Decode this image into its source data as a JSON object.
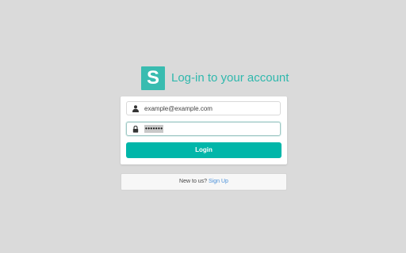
{
  "header": {
    "logo_letter": "S",
    "title": "Log-in to your account"
  },
  "form": {
    "email_value": "example@example.com",
    "email_icon": "user-icon",
    "password_value": "•••••••",
    "password_icon": "lock-icon",
    "login_label": "Login"
  },
  "signup": {
    "prompt": "New to us?",
    "link_label": "Sign Up"
  },
  "colors": {
    "background": "#dadada",
    "brand": "#39bcb0",
    "button": "#00b6a9",
    "link": "#4a90d9"
  }
}
